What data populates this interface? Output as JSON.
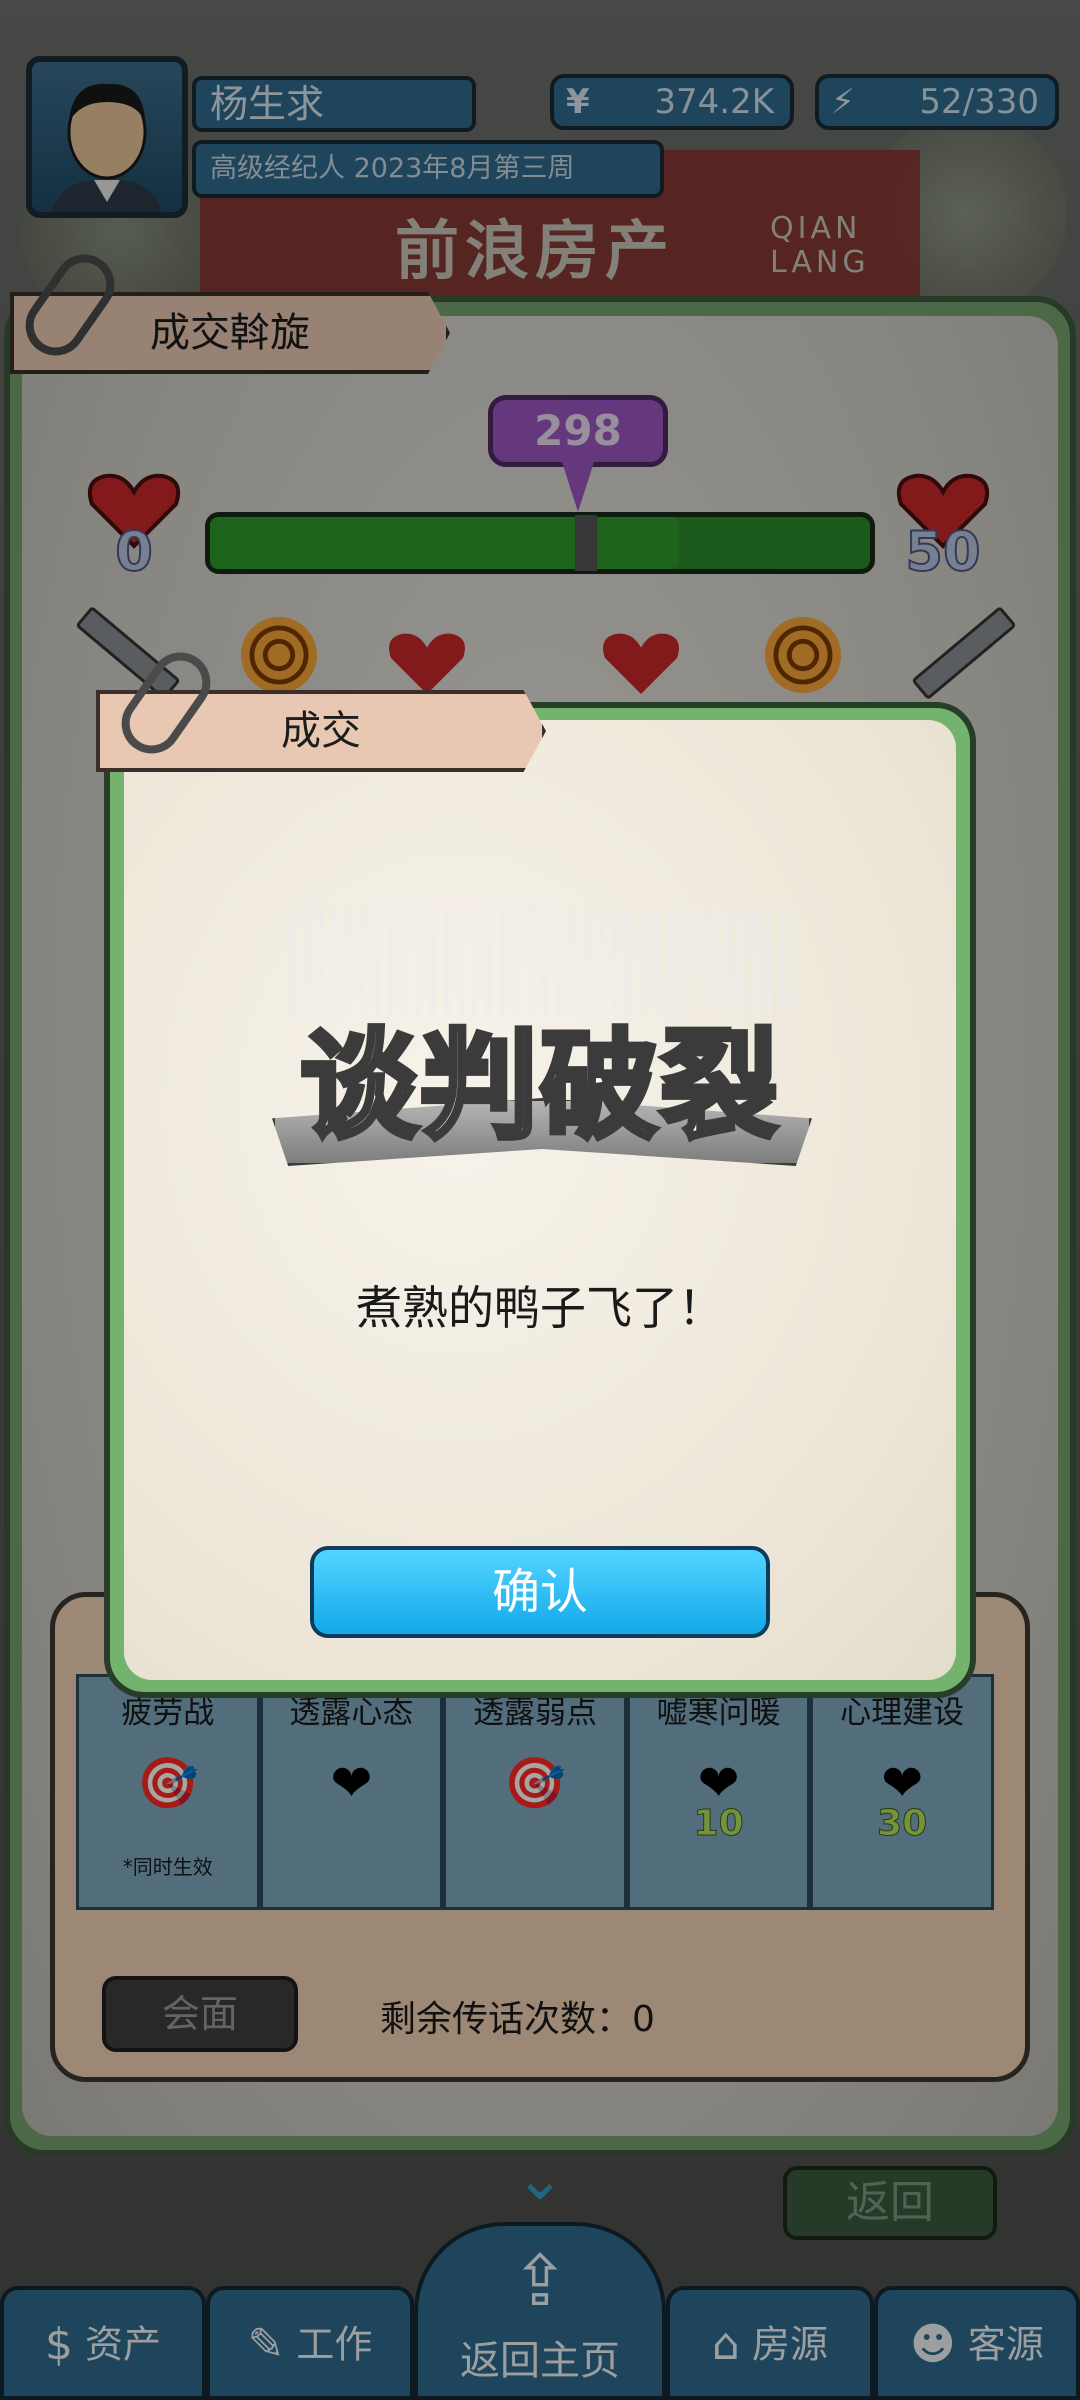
{
  "header": {
    "player_name": "杨生求",
    "player_title": "高级经纪人 2023年8月第三周",
    "money_icon": "¥",
    "money": "374.2K",
    "energy_icon": "lightning-icon",
    "energy": "52/330"
  },
  "background": {
    "sign_text": "前浪房产",
    "sign_sub": "QIAN LANG"
  },
  "panel": {
    "title": "成交斡旋",
    "left_heart_value": "0",
    "right_heart_value": "50",
    "marker_value": "298",
    "progress_fraction": 0.71
  },
  "skills": [
    {
      "label": "疲劳战",
      "icon": "target-lock-icon",
      "num": "",
      "note": "*同时生效"
    },
    {
      "label": "透露心态",
      "icon": "heart-shield-icon",
      "num": "",
      "note": ""
    },
    {
      "label": "透露弱点",
      "icon": "target-up-icon",
      "num": "",
      "note": ""
    },
    {
      "label": "嘘寒问暖",
      "icon": "heart-plus-icon",
      "num": "10",
      "note": ""
    },
    {
      "label": "心理建设",
      "icon": "heart-plus-icon",
      "num": "30",
      "note": ""
    }
  ],
  "meet_button": "会面",
  "remaining_text": "剩余传话次数：0",
  "back_button": "返回",
  "nav": {
    "assets": "资产",
    "work": "工作",
    "home": "返回主页",
    "listings": "房源",
    "clients": "客源"
  },
  "dialog": {
    "tag": "成交",
    "headline": "谈判破裂",
    "message": "煮熟的鸭子飞了！",
    "confirm": "确认"
  }
}
